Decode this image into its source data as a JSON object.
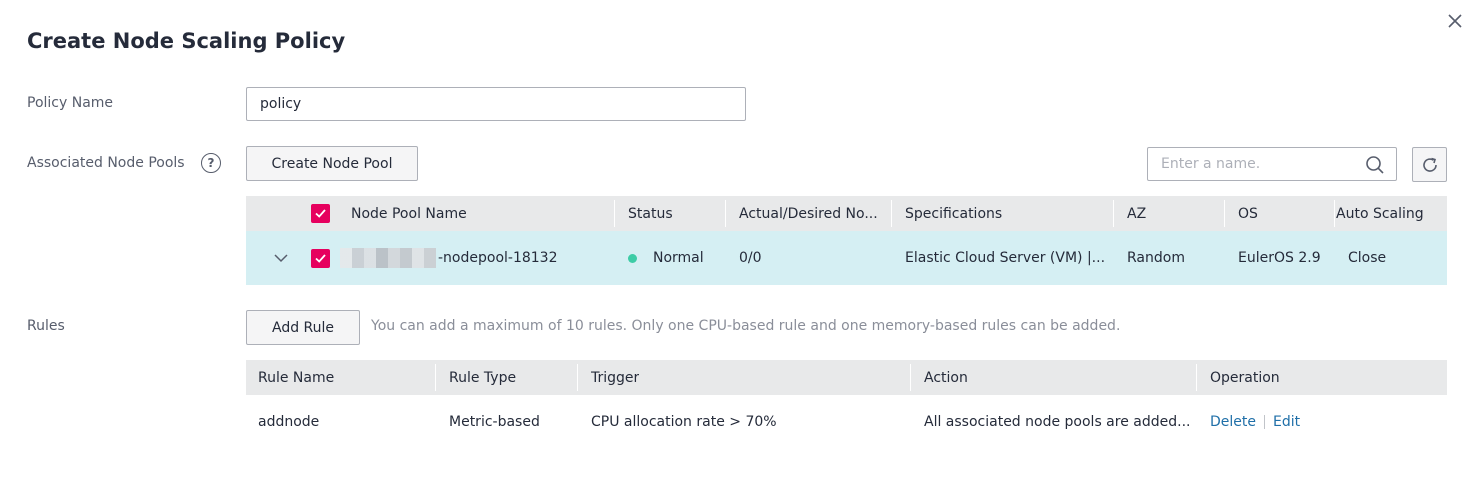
{
  "dialog": {
    "title": "Create Node Scaling Policy"
  },
  "policy_name": {
    "label": "Policy Name",
    "value": "policy"
  },
  "node_pools": {
    "label": "Associated Node Pools",
    "help_glyph": "?",
    "create_button": "Create Node Pool",
    "search_placeholder": "Enter a name.",
    "columns": [
      "Node Pool Name",
      "Status",
      "Actual/Desired No...",
      "Specifications",
      "AZ",
      "OS",
      "Auto Scaling"
    ],
    "rows": [
      {
        "name": "-nodepool-18132",
        "status": "Normal",
        "actual_desired": "0/0",
        "specifications": "Elastic Cloud Server (VM) |...",
        "az": "Random",
        "os": "EulerOS 2.9",
        "auto_scaling": "Close",
        "selected": true
      }
    ],
    "status_color": "#3dcca6",
    "accent_color": "#e6005e"
  },
  "rules": {
    "label": "Rules",
    "add_button": "Add Rule",
    "hint": "You can add a maximum of 10 rules. Only one CPU-based rule and one memory-based rules can be added.",
    "columns": [
      "Rule Name",
      "Rule Type",
      "Trigger",
      "Action",
      "Operation"
    ],
    "rows": [
      {
        "name": "addnode",
        "type": "Metric-based",
        "trigger": "CPU allocation rate > 70%",
        "action": "All associated node pools are added...",
        "delete": "Delete",
        "edit": "Edit"
      }
    ]
  }
}
